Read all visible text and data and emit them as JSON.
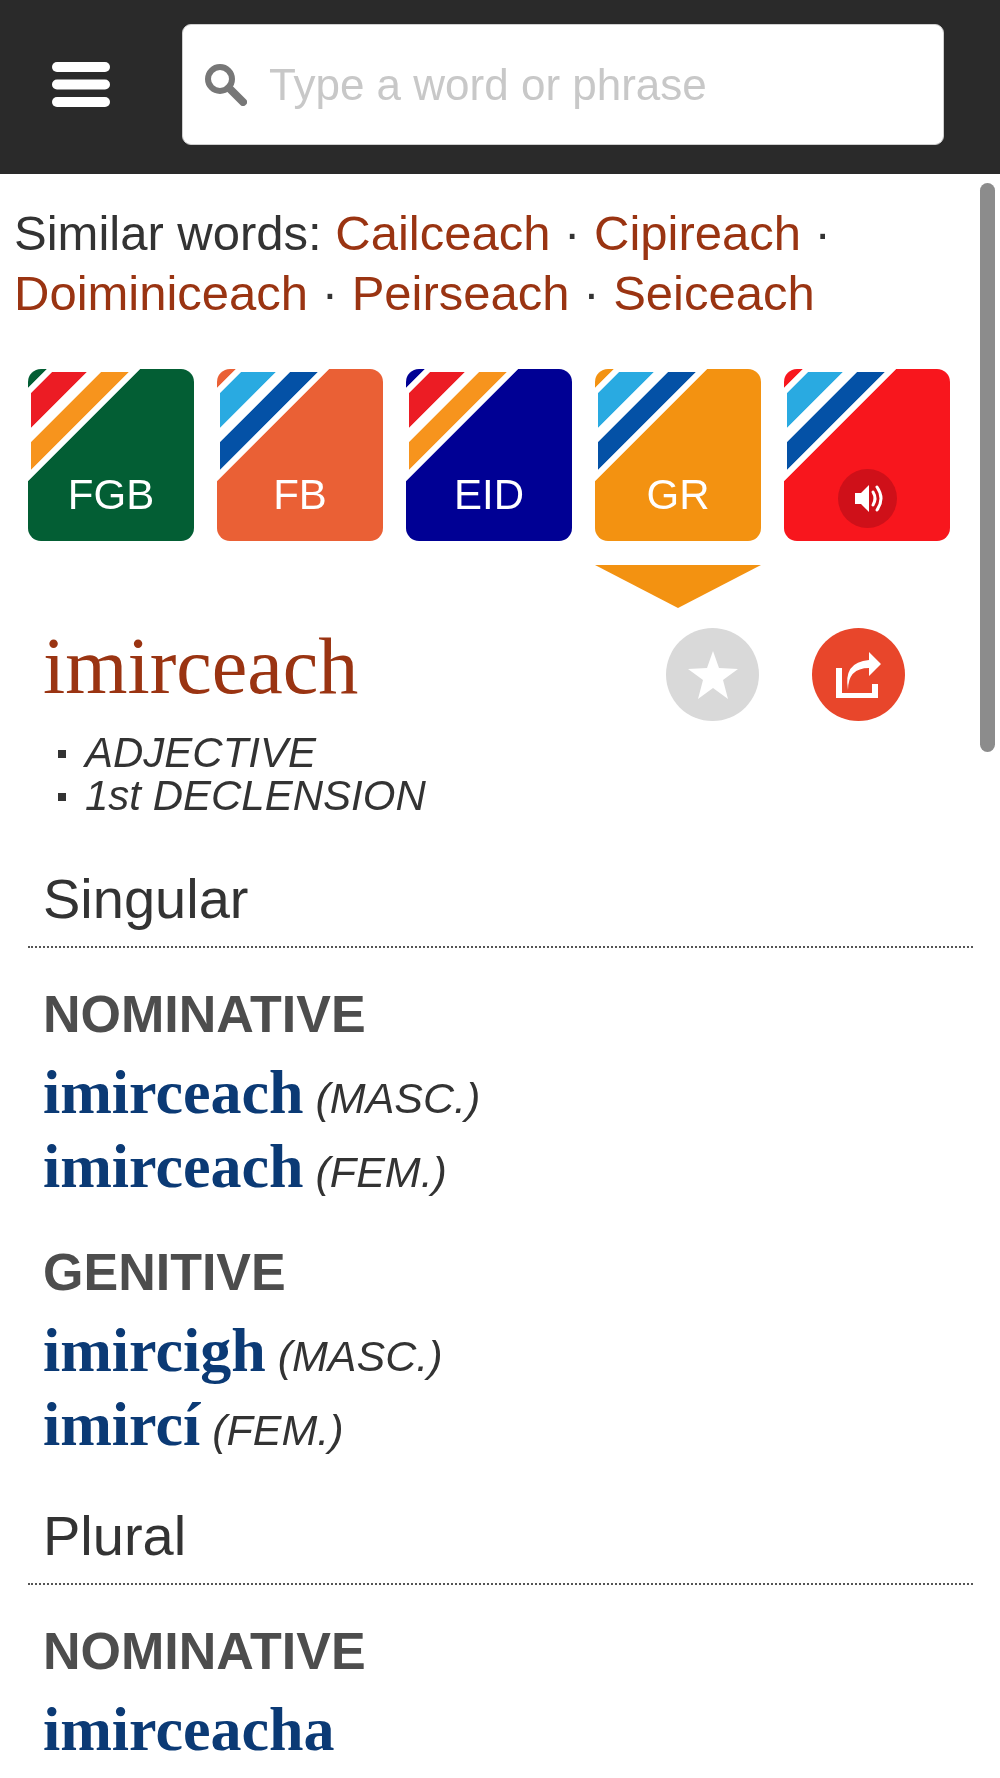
{
  "header": {
    "search": {
      "placeholder": "Type a word or phrase"
    }
  },
  "similar_words": {
    "label": "Similar words:",
    "separator": "·",
    "words": [
      "Cailceach",
      "Cipireach",
      "Doiminiceach",
      "Peirseach",
      "Seiceach"
    ]
  },
  "sources": [
    {
      "kind": "text",
      "label": "FGB",
      "color": "#035e34",
      "stripes": [
        {
          "color": "#ec1c24"
        },
        {
          "color": "#f7941d"
        }
      ],
      "selected": false
    },
    {
      "kind": "text",
      "label": "FB",
      "color": "#ea6035",
      "stripes": [
        {
          "color": "#29aae1"
        },
        {
          "color": "#0451a6"
        }
      ],
      "selected": false
    },
    {
      "kind": "text",
      "label": "EID",
      "color": "#000094",
      "stripes": [
        {
          "color": "#ec1c24"
        },
        {
          "color": "#f7941d"
        }
      ],
      "selected": false
    },
    {
      "kind": "text",
      "label": "GR",
      "color": "#f39211",
      "stripes": [
        {
          "color": "#29aae1"
        },
        {
          "color": "#0451a6"
        }
      ],
      "selected": true
    },
    {
      "kind": "audio",
      "color": "#f8161d",
      "stripes": [
        {
          "color": "#29aae1"
        },
        {
          "color": "#0451a6"
        }
      ],
      "selected": false
    }
  ],
  "entry": {
    "headword": "imirceach",
    "starred": false,
    "grammar": [
      "ADJECTIVE",
      "1st DECLENSION"
    ]
  },
  "sections": [
    {
      "title": "Singular",
      "cases": [
        {
          "name": "NOMINATIVE",
          "forms": [
            {
              "word": "imirceach",
              "gender": "(MASC.)"
            },
            {
              "word": "imirceach",
              "gender": "(FEM.)"
            }
          ]
        },
        {
          "name": "GENITIVE",
          "forms": [
            {
              "word": "imircigh",
              "gender": "(MASC.)"
            },
            {
              "word": "imircí",
              "gender": "(FEM.)"
            }
          ]
        }
      ]
    },
    {
      "title": "Plural",
      "cases": [
        {
          "name": "NOMINATIVE",
          "forms": [
            {
              "word": "imirceacha"
            }
          ]
        }
      ]
    }
  ]
}
